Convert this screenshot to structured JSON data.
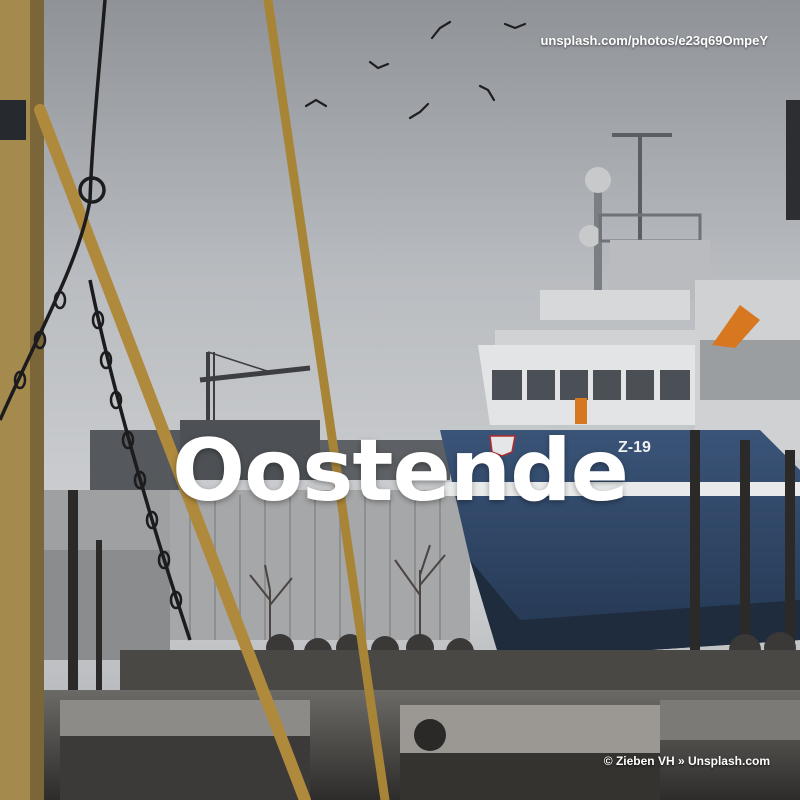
{
  "photo": {
    "title": "Oostende",
    "source_url": "unsplash.com/photos/e23q69OmpeY",
    "credit": "© Zieben VH » Unsplash.com",
    "hull_marking": "Z-19"
  },
  "colors": {
    "sky": "#c9cccf",
    "hull_blue": "#2f4766",
    "wheelhouse": "#e2e4e6",
    "mast_yellow": "#b08a3c",
    "accent_orange": "#d7771f"
  }
}
